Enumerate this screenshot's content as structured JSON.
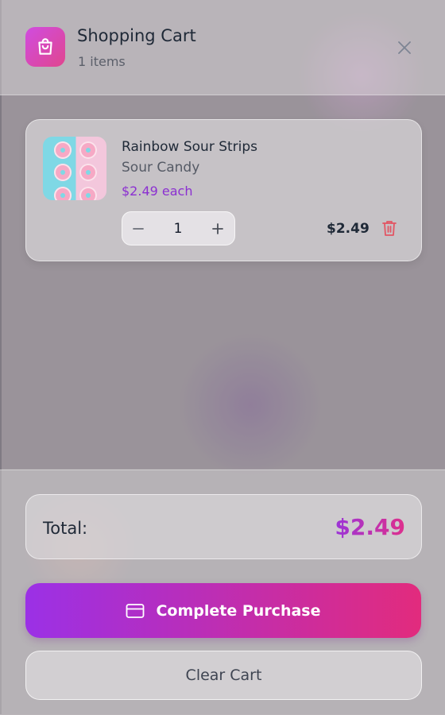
{
  "header": {
    "title": "Shopping Cart",
    "item_count": "1 items",
    "icon": "shopping-bag-icon",
    "close_icon": "close-icon"
  },
  "cart": {
    "items": [
      {
        "name": "Rainbow Sour Strips",
        "category": "Sour Candy",
        "unit_price": "$2.49 each",
        "quantity": "1",
        "line_total": "$2.49",
        "image": "donuts-thumbnail"
      }
    ]
  },
  "summary": {
    "total_label": "Total:",
    "total_value": "$2.49"
  },
  "actions": {
    "purchase_label": "Complete Purchase",
    "clear_label": "Clear Cart"
  },
  "colors": {
    "accent_start": "#9b30e6",
    "accent_end": "#e22b7d",
    "price_purple": "#8b2fd1",
    "delete_red": "#e25563"
  }
}
